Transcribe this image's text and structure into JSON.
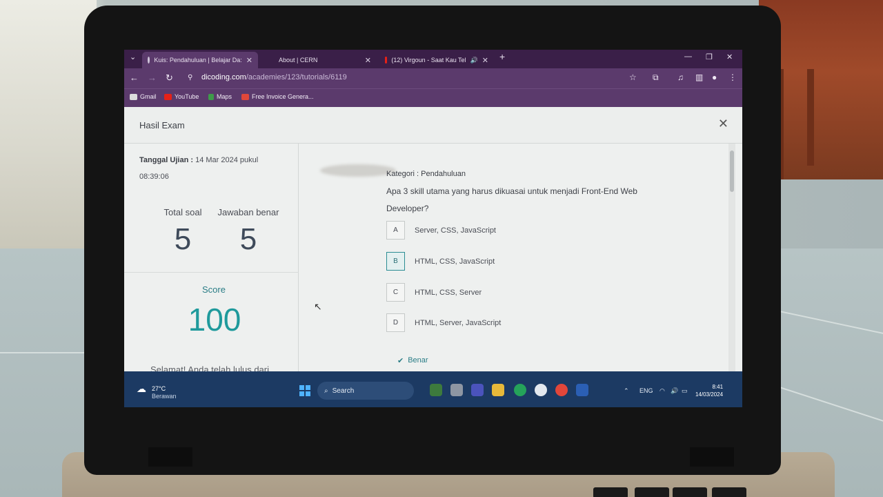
{
  "browser": {
    "tabs": [
      {
        "title": "Kuis: Pendahuluan | Belajar Da:",
        "active": true
      },
      {
        "title": "About | CERN",
        "active": false
      },
      {
        "title": "(12) Virgoun - Saat Kau Tel",
        "active": false
      }
    ],
    "url_host": "dicoding.com",
    "url_path": "/academies/123/tutorials/6119",
    "bookmarks": [
      "Gmail",
      "YouTube",
      "Maps",
      "Free Invoice Genera..."
    ]
  },
  "modal": {
    "title": "Hasil Exam",
    "date_label": "Tanggal Ujian :",
    "date_value": "14 Mar 2024 pukul",
    "time_value": "08:39:06",
    "total_label": "Total soal",
    "total_value": "5",
    "correct_label": "Jawaban benar",
    "correct_value": "5",
    "score_label": "Score",
    "score_value": "100",
    "congrats": "Selamat! Anda telah lulus dari"
  },
  "question": {
    "category": "Kategori : Pendahuluan",
    "text": "Apa 3 skill utama yang harus dikuasai untuk menjadi Front-End Web Developer?",
    "options": [
      {
        "key": "A",
        "text": "Server, CSS, JavaScript"
      },
      {
        "key": "B",
        "text": "HTML, CSS, JavaScript",
        "selected": true
      },
      {
        "key": "C",
        "text": "HTML, CSS, Server"
      },
      {
        "key": "D",
        "text": "HTML, Server, JavaScript"
      }
    ],
    "result": "Benar"
  },
  "taskbar": {
    "weather_temp": "27°C",
    "weather_cond": "Berawan",
    "search": "Search",
    "lang": "ENG",
    "time": "8:41",
    "date": "14/03/2024"
  },
  "colors": {
    "accent": "#1f9a9c",
    "browser": "#5b3a6c",
    "taskbar": "#1c3a63"
  }
}
